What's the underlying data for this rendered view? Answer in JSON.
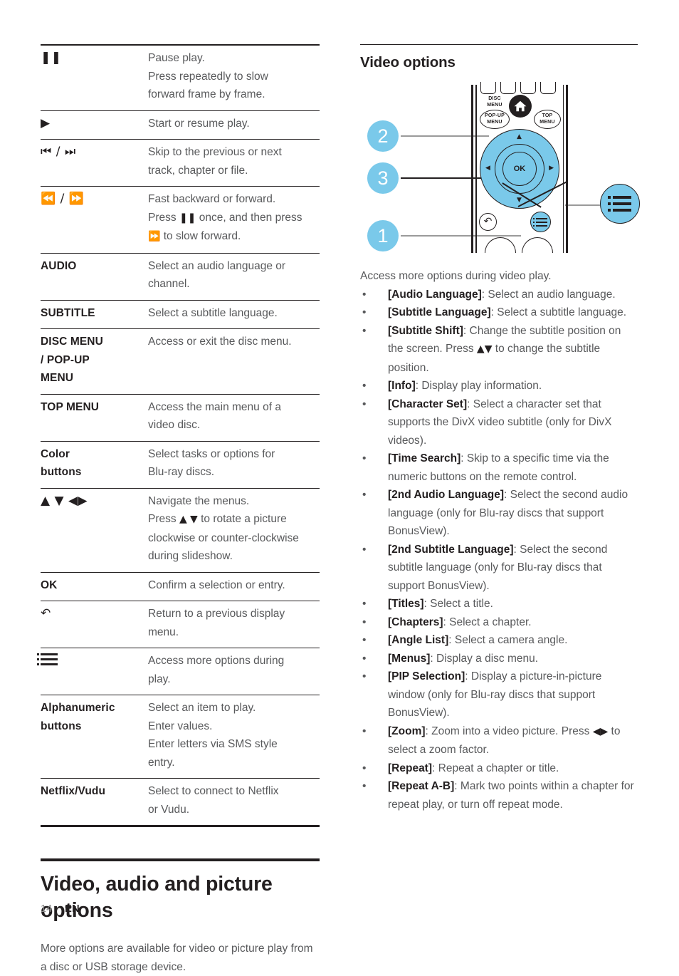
{
  "page": {
    "number": "14",
    "language": "EN"
  },
  "left_column": {
    "key_table": {
      "rows": [
        {
          "key": "❚❚",
          "key_is_symbol": true,
          "desc": "Pause play.\nPress repeatedly to slow\nforward frame by frame."
        },
        {
          "key": "▶",
          "key_is_symbol": true,
          "desc": "Start or resume play."
        },
        {
          "key": "⏮ / ⏭",
          "key_is_symbol": true,
          "desc": "Skip to the previous or next\ntrack, chapter or file."
        },
        {
          "key": "⏪ / ⏩",
          "key_is_symbol": true,
          "desc": "Fast backward or forward.\nPress ❚❚ once, and then press\n⏩ to slow forward."
        },
        {
          "key": "AUDIO",
          "key_is_symbol": false,
          "desc": "Select an audio language or\nchannel."
        },
        {
          "key": "SUBTITLE",
          "key_is_symbol": false,
          "desc": "Select a subtitle language."
        },
        {
          "key": "DISC MENU\n/ POP-UP\nMENU",
          "key_is_symbol": false,
          "desc": "Access or exit the disc menu."
        },
        {
          "key": "TOP MENU",
          "key_is_symbol": false,
          "desc": "Access the main menu of a\nvideo disc."
        },
        {
          "key": "Color\nbuttons",
          "key_is_symbol": false,
          "desc": "Select tasks or options for\nBlu-ray discs."
        },
        {
          "key": "▲ ▼ ◀▶",
          "key_is_symbol": true,
          "desc": "Navigate the menus.\nPress ▲ ▼ to rotate a picture\nclockwise or counter-clockwise\nduring slideshow."
        },
        {
          "key": "OK",
          "key_is_symbol": false,
          "desc": "Confirm a selection or entry."
        },
        {
          "key": "↶",
          "key_is_symbol": true,
          "desc": "Return to a previous display\nmenu."
        },
        {
          "key": "options-list-icon",
          "key_is_symbol": true,
          "desc": "Access more options during\nplay."
        },
        {
          "key": "Alphanumeric\nbuttons",
          "key_is_symbol": false,
          "desc": "Select an item to play.\nEnter values.\nEnter letters via SMS style\nentry."
        },
        {
          "key": "Netflix/Vudu",
          "key_is_symbol": false,
          "desc": "Select to connect to Netflix\nor Vudu."
        }
      ]
    },
    "section": {
      "title": "Video, audio and picture options",
      "paragraph": "More options are available for video or picture play from a disc or USB storage device."
    }
  },
  "right_column": {
    "heading": "Video options",
    "figure": {
      "callouts": [
        "2",
        "3",
        "1"
      ],
      "remote": {
        "disc_menu_label": "DISC\nMENU",
        "popup_menu_label": "POP-UP\nMENU",
        "top_menu_label": "TOP\nMENU",
        "ok_label": "OK",
        "home_icon": "home-icon",
        "back_icon": "return-arrow-icon",
        "options_icon": "options-list-icon"
      }
    },
    "intro": "Access more options during video play.",
    "bullets": [
      {
        "term": "[Audio Language]",
        "text": ": Select an audio language."
      },
      {
        "term": "[Subtitle Language]",
        "text": ": Select a subtitle language."
      },
      {
        "term": "[Subtitle Shift]",
        "text": ": Change the subtitle position on the screen. Press ▲▼ to change the subtitle position."
      },
      {
        "term": "[Info]",
        "text": ": Display play information."
      },
      {
        "term": "[Character Set]",
        "text": ": Select a character set that supports the DivX video subtitle (only for DivX videos)."
      },
      {
        "term": "[Time Search]",
        "text": ": Skip to a specific time via the numeric buttons on the remote control."
      },
      {
        "term": "[2nd Audio Language]",
        "text": ": Select the second audio language (only for Blu-ray discs that support BonusView)."
      },
      {
        "term": "[2nd Subtitle Language]",
        "text": ": Select the second subtitle language (only for Blu-ray discs that support BonusView)."
      },
      {
        "term": "[Titles]",
        "text": ": Select a title."
      },
      {
        "term": "[Chapters]",
        "text": ": Select a chapter."
      },
      {
        "term": "[Angle List]",
        "text": ": Select a camera angle."
      },
      {
        "term": "[Menus]",
        "text": ": Display a disc menu."
      },
      {
        "term": "[PIP Selection]",
        "text": ": Display a picture-in-picture window (only for Blu-ray discs that support BonusView)."
      },
      {
        "term": "[Zoom]",
        "text": ": Zoom into a video picture. Press ◀▶ to select a zoom factor."
      },
      {
        "term": "[Repeat]",
        "text": ": Repeat a chapter or title."
      },
      {
        "term": "[Repeat A-B]",
        "text": ": Mark two points within a chapter for repeat play, or turn off repeat mode."
      }
    ]
  },
  "colors": {
    "accent_blue": "#7ac9ea",
    "ink": "#231f20",
    "body_text": "#58595b"
  }
}
